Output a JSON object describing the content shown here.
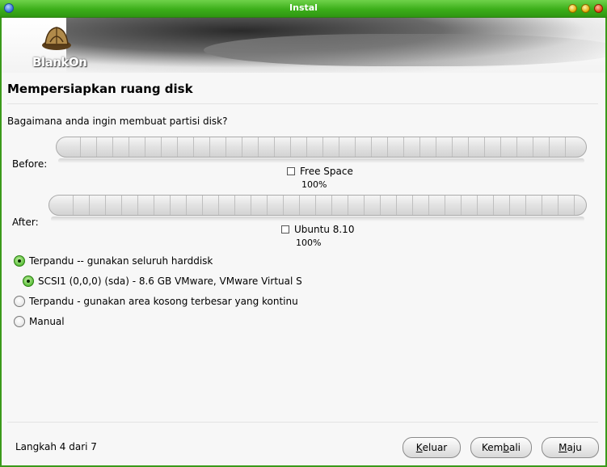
{
  "window": {
    "title": "Instal"
  },
  "logo": {
    "text": "BlankOn"
  },
  "page": {
    "title": "Mempersiapkan ruang disk",
    "question": "Bagaimana anda ingin membuat partisi disk?"
  },
  "before": {
    "label": "Before:",
    "legend": "Free Space",
    "percent": "100%"
  },
  "after": {
    "label": "After:",
    "legend": "Ubuntu 8.10",
    "percent": "100%"
  },
  "options": [
    {
      "label": "Terpandu -- gunakan seluruh harddisk",
      "selected": true
    },
    {
      "label": "SCSI1 (0,0,0) (sda) - 8.6 GB VMware, VMware Virtual S",
      "selected": true
    },
    {
      "label": "Terpandu - gunakan area kosong terbesar yang kontinu",
      "selected": false
    },
    {
      "label": "Manual",
      "selected": false
    }
  ],
  "footer": {
    "step": "Langkah 4 dari 7",
    "quit": {
      "mnemonic": "K",
      "rest": "eluar"
    },
    "back": {
      "pre": "Kem",
      "mnemonic": "b",
      "rest": "ali"
    },
    "next": {
      "mnemonic": "M",
      "rest": "aju"
    }
  },
  "colors": {
    "titlebar": "#3cae1a",
    "radio_selected": "#4cb82a"
  }
}
